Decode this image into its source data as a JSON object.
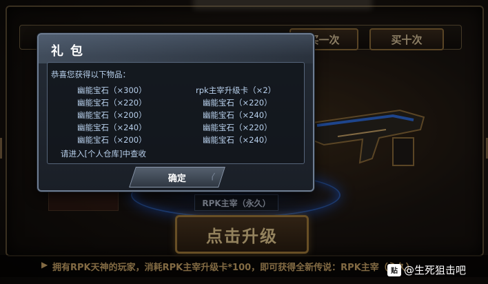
{
  "background": {
    "buttons": [
      "买一次",
      "买十次"
    ],
    "weapon_label": "RPK主宰（永久）",
    "upgrade_button": "点击升级",
    "ticker": "拥有RPK天神的玩家，消耗RPK主宰升级卡*100，即可获得全新传说：RPK主宰（永久）"
  },
  "watermark": {
    "logo": "贴",
    "text": "@生死狙击吧"
  },
  "dialog": {
    "title": "礼包",
    "congrats": "恭喜您获得以下物品：",
    "items_left": [
      "幽能宝石（×300）",
      "幽能宝石（×220）",
      "幽能宝石（×200）",
      "幽能宝石（×240）",
      "幽能宝石（×200）"
    ],
    "items_right": [
      "rpk主宰升级卡（×2）",
      "幽能宝石（×220）",
      "幽能宝石（×240）",
      "幽能宝石（×220）",
      "幽能宝石（×240）"
    ],
    "note": "请进入[个人仓库]中查收",
    "confirm": "确定"
  },
  "colors": {
    "accent_gold": "#c8a468",
    "dialog_text": "#b8d0ec",
    "platform_blue": "#2a58a8"
  }
}
